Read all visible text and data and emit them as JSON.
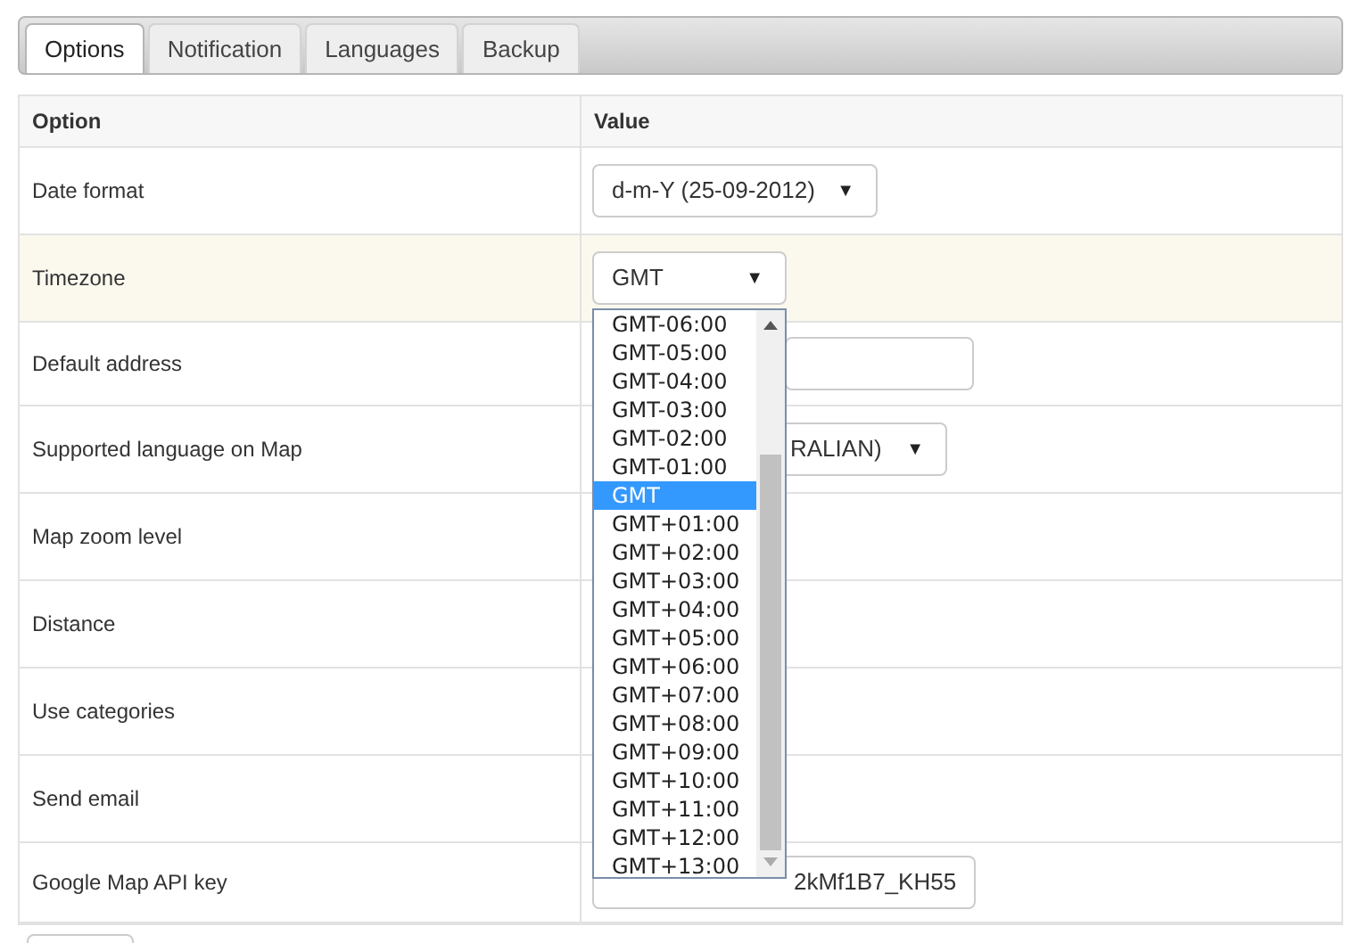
{
  "tabs": [
    {
      "label": "Options",
      "selected": true
    },
    {
      "label": "Notification",
      "selected": false
    },
    {
      "label": "Languages",
      "selected": false
    },
    {
      "label": "Backup",
      "selected": false
    }
  ],
  "table": {
    "columns": [
      "Option",
      "Value"
    ],
    "rows": [
      {
        "option": "Date format",
        "highlighted": false,
        "value": {
          "kind": "select",
          "text": "d-m-Y (25-09-2012)",
          "arrow": "▼"
        }
      },
      {
        "option": "Timezone",
        "highlighted": true,
        "value": {
          "kind": "select",
          "text": "GMT",
          "arrow": "▼"
        }
      },
      {
        "option": "Default address",
        "highlighted": false,
        "value": {
          "kind": "input"
        }
      },
      {
        "option": "Supported language on Map",
        "highlighted": false,
        "value": {
          "kind": "select",
          "text": "RALIAN)",
          "arrow": "▼"
        }
      },
      {
        "option": "Map zoom level",
        "highlighted": false
      },
      {
        "option": "Distance",
        "highlighted": false
      },
      {
        "option": "Use categories",
        "highlighted": false
      },
      {
        "option": "Send email",
        "highlighted": false
      },
      {
        "option": "Google Map API key",
        "highlighted": false,
        "value": {
          "kind": "input",
          "text": "2kMf1B7_KH55"
        }
      }
    ]
  },
  "timezone_dropdown": {
    "options": [
      {
        "label": "GMT-06:00",
        "selected": false
      },
      {
        "label": "GMT-05:00",
        "selected": false
      },
      {
        "label": "GMT-04:00",
        "selected": false
      },
      {
        "label": "GMT-03:00",
        "selected": false
      },
      {
        "label": "GMT-02:00",
        "selected": false
      },
      {
        "label": "GMT-01:00",
        "selected": false
      },
      {
        "label": "GMT",
        "selected": true
      },
      {
        "label": "GMT+01:00",
        "selected": false
      },
      {
        "label": "GMT+02:00",
        "selected": false
      },
      {
        "label": "GMT+03:00",
        "selected": false
      },
      {
        "label": "GMT+04:00",
        "selected": false
      },
      {
        "label": "GMT+05:00",
        "selected": false
      },
      {
        "label": "GMT+06:00",
        "selected": false
      },
      {
        "label": "GMT+07:00",
        "selected": false
      },
      {
        "label": "GMT+08:00",
        "selected": false
      },
      {
        "label": "GMT+09:00",
        "selected": false
      },
      {
        "label": "GMT+10:00",
        "selected": false
      },
      {
        "label": "GMT+11:00",
        "selected": false
      },
      {
        "label": "GMT+12:00",
        "selected": false
      },
      {
        "label": "GMT+13:00",
        "selected": false
      }
    ]
  }
}
